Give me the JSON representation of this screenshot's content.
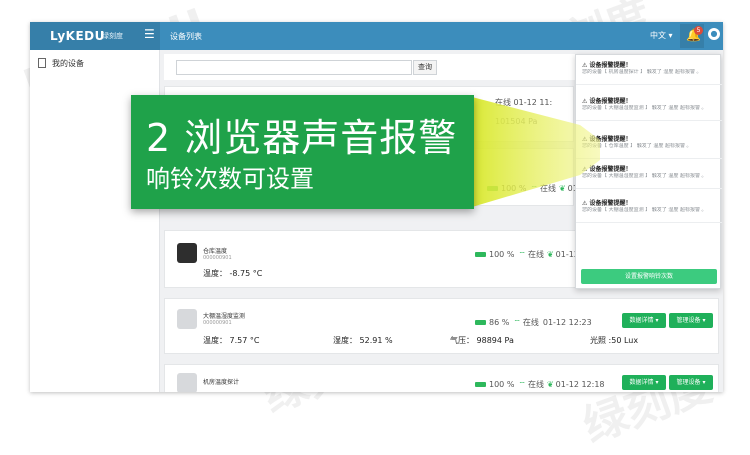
{
  "header": {
    "logo": "LyKEDU",
    "logo_sub": "绿刻度",
    "page_title": "设备列表",
    "language": "中文 ▾",
    "notification_count": "5"
  },
  "sidebar": {
    "items": [
      {
        "label": "我的设备"
      }
    ]
  },
  "search": {
    "placeholder": "",
    "button": "查询"
  },
  "cards": [
    {
      "name": "",
      "id": "",
      "reading": "101504 Pa",
      "status_text": "在线 01-12 11:"
    },
    {
      "battery": "100 %",
      "online": "在线",
      "time": "01-12"
    },
    {
      "name": "仓库温度",
      "id": "000000901",
      "reading": "温度： -8.75 °C",
      "battery": "100 %",
      "online": "在线",
      "time": "01-12"
    },
    {
      "name": "大棚温湿度监测",
      "id": "000000901",
      "temp": "温度： 7.57 °C",
      "humidity": "湿度： 52.91 %",
      "pressure": "气压： 98894 Pa",
      "light": "光照 :50 Lux",
      "battery": "86 %",
      "online": "在线",
      "time": "01-12 12:23",
      "btn_detail": "数据详情 ▾",
      "btn_manage": "管理设备 ▾"
    },
    {
      "name": "机房温度探计",
      "battery": "100 %",
      "online": "在线",
      "time": "01-12 12:18",
      "btn_detail": "数据详情 ▾",
      "btn_manage": "管理设备 ▾"
    }
  ],
  "notifications": {
    "items": [
      {
        "title": "设备报警提醒！",
        "text": "您的设备【 机房温度探计 】 触发了 湿度 超标报警 。"
      },
      {
        "title": "设备报警提醒！",
        "text": "您的设备【 大棚温湿度监测 】 触发了 温度 超标报警 。"
      },
      {
        "title": "设备报警提醒！",
        "text": "您的设备【 仓库温度 】 触发了 温度 超标报警 。"
      },
      {
        "title": "设备报警提醒！",
        "text": "您的设备【 大棚温湿度监测 】 触发了 温度 超标报警 。"
      },
      {
        "title": "设备报警提醒！",
        "text": "您的设备【 大棚温湿度监测 】 触发了 湿度 超标报警 。"
      }
    ],
    "button": "设置报警响铃次数"
  },
  "banner": {
    "title": "2 浏览器声音报警",
    "subtitle": "响铃次数可设置"
  },
  "watermark": {
    "text1": "LyKEDU",
    "text2": "绿刻度",
    "text3": "绿刻度",
    "text4": "绿刻度"
  },
  "colors": {
    "topbar": "#3c8dbc",
    "accent_green": "#1fa24a",
    "button_green": "#1fb05a"
  }
}
